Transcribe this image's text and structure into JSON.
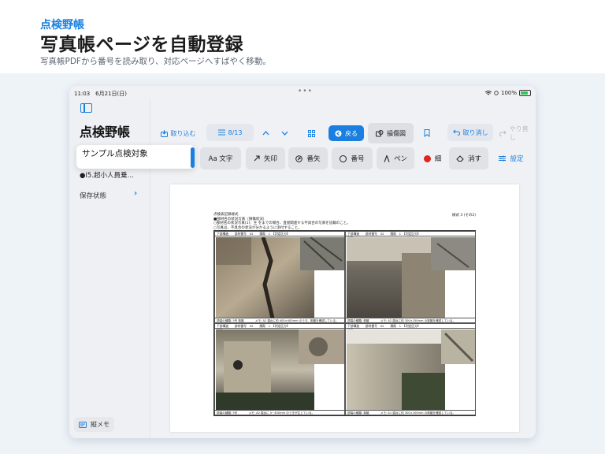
{
  "promo": {
    "app_name": "点検野帳",
    "headline": "写真帳ページを自動登録",
    "subtitle": "写真帳PDFから番号を読み取り、対応ページへすばやく移動。"
  },
  "status_bar": {
    "time_date": "11:03　6月21日(日)",
    "dots": "•••",
    "battery": "100%"
  },
  "sidebar": {
    "title": "点検野帳",
    "item_truncated": "●I5.超小人員乗…",
    "save_status": "保存状態",
    "memo_button": "縦メモ"
  },
  "popover": {
    "label": "サンプル点検対象"
  },
  "toolbar": {
    "import": "取り込む",
    "page_counter": "8/13",
    "back": "戻る",
    "damage_map": "損傷図",
    "undo": "取り消し",
    "redo": "やり直し"
  },
  "tools": {
    "text": "Aa 文字",
    "arrow": "矢印",
    "numbered_arrow": "番矢",
    "number": "番号",
    "pen": "ペン",
    "color": "細",
    "erase": "消す",
    "settings": "設定"
  },
  "document": {
    "header_left": "点検表記録様式\n■部材名の状況写真（損傷状況）\n○部材名の状況写真(1)：主 をまでの場合、直接関連する不具合の写真を記載のこと。\n○写真は、不具合の状況が分かるように添付すること。",
    "header_right": "様式 3 (その2)",
    "cells": [
      {
        "meta": "下部構造　　部材番号　02　　損傷　1　【判定区分】",
        "num": "写真 9",
        "caption": "損傷の種類: 5号 剥離　　　　メモ: A2 橋台に約 400×400mm のうき、剥離を確認している。"
      },
      {
        "meta": "下部構造　　部材番号　02　　損傷　1　【判定区分】",
        "num": "写真 10",
        "caption": "損傷の種類: 剥離　　　　メモ: A2 橋台に約 300×150mm の剥離を確認している。"
      },
      {
        "meta": "下部構造　　部材番号　02　　損傷　1　【判定区分】",
        "num": "写真 11",
        "caption": "損傷の種類: 5号　　　　メモ: A2 橋台に 0~400mm のうきが生じている。"
      },
      {
        "meta": "下部構造　　部材番号　02　　損傷　1　【判定区分】",
        "num": "写真 12",
        "caption": "損傷の種類: 剥離　　　　メモ: A1 橋台に約 300×100mm の剥離を確認している。"
      }
    ]
  },
  "colors": {
    "accent": "#1a7fe0",
    "pen_color": "#e0241f"
  }
}
